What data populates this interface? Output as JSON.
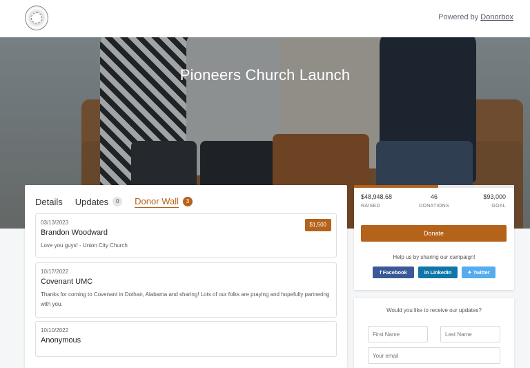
{
  "header": {
    "powered_prefix": "Powered by",
    "powered_link": "Donorbox"
  },
  "hero": {
    "title": "Pioneers Church Launch"
  },
  "tabs": [
    {
      "label": "Details"
    },
    {
      "label": "Updates",
      "count": "0"
    },
    {
      "label": "Donor Wall",
      "count": "3",
      "active": true
    }
  ],
  "donors": [
    {
      "date": "03/13/2023",
      "name": "Brandon Woodward",
      "message": "Love you guys! - Union City Church",
      "amount": "$1,500"
    },
    {
      "date": "10/17/2022",
      "name": "Covenant UMC",
      "message": "Thanks for coming to Covenant in Dothan, Alabama and sharing! Lots of our folks are praying and hopefully partnering with you."
    },
    {
      "date": "10/10/2022",
      "name": "Anonymous"
    }
  ],
  "stats": {
    "raised_value": "$48,948.68",
    "raised_label": "RAISED",
    "donations_value": "46",
    "donations_label": "DONATIONS",
    "goal_value": "$93,000",
    "goal_label": "GOAL",
    "progress_fraction": 0.526
  },
  "donate_label": "Donate",
  "share": {
    "text": "Help us by sharing our campaign!",
    "facebook": "Facebook",
    "linkedin": "LinkedIn",
    "twitter": "Twitter"
  },
  "subscribe": {
    "title": "Would you like to receive our updates?",
    "first_placeholder": "First Name",
    "last_placeholder": "Last Name",
    "email_placeholder": "Your email"
  },
  "colors": {
    "accent": "#b5621b",
    "facebook": "#3b5998",
    "linkedin": "#0e76a8",
    "twitter": "#55acee"
  }
}
